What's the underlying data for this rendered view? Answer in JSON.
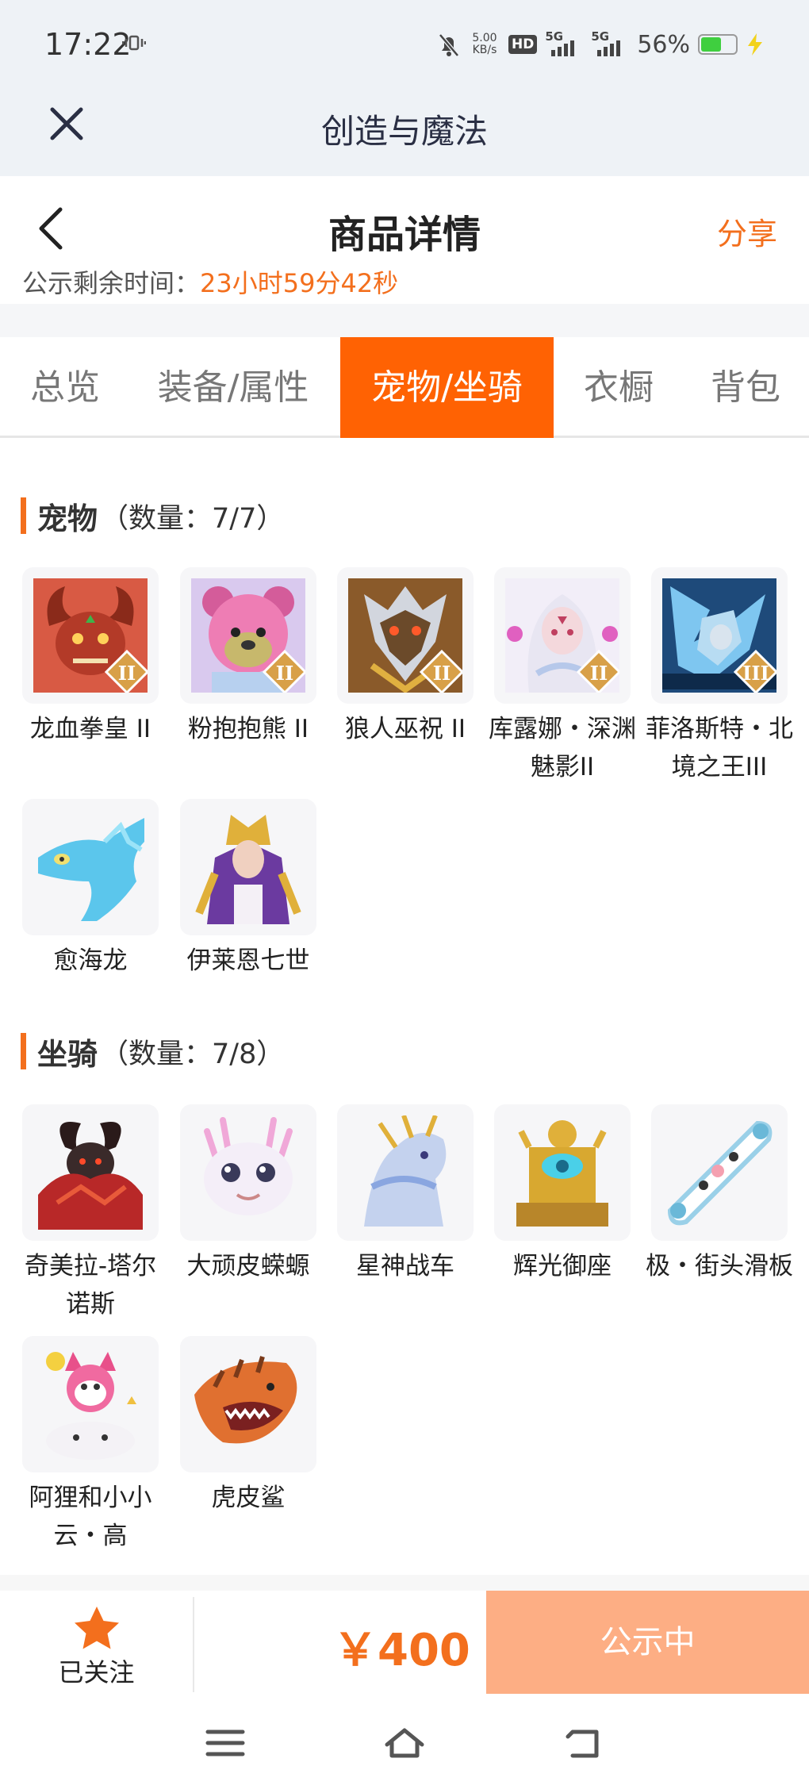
{
  "status_bar": {
    "time": "17:22",
    "net_speed": "5.00",
    "net_unit": "KB/s",
    "hd": "HD",
    "sig1": "5G",
    "sig2": "5G",
    "battery": "56%",
    "battery_level": 0.56
  },
  "app_header": {
    "title": "创造与魔法",
    "close_icon": "close-icon"
  },
  "page_header": {
    "title": "商品详情",
    "share": "分享"
  },
  "timer": {
    "label": "公示剩余时间：",
    "value": "23小时59分42秒"
  },
  "tabs": [
    {
      "label": "总览",
      "active": false
    },
    {
      "label": "装备/属性",
      "active": false
    },
    {
      "label": "宠物/坐骑",
      "active": true
    },
    {
      "label": "衣橱",
      "active": false
    },
    {
      "label": "背包",
      "active": false
    }
  ],
  "pets": {
    "name": "宠物",
    "count": "（数量：7/7）",
    "items": [
      {
        "label": "龙血拳皇 II",
        "icon": "red-dragon-icon",
        "badge": "II"
      },
      {
        "label": "粉抱抱熊 II",
        "icon": "pink-bear-icon",
        "badge": "II"
      },
      {
        "label": "狼人巫祝 II",
        "icon": "werewolf-icon",
        "badge": "II"
      },
      {
        "label": "库露娜・深渊魅影II",
        "icon": "white-hair-spirit-icon",
        "badge": "II"
      },
      {
        "label": "菲洛斯特・北境之王III",
        "icon": "ice-king-icon",
        "badge": "III"
      },
      {
        "label": "愈海龙",
        "icon": "sea-dragon-icon",
        "badge": ""
      },
      {
        "label": "伊莱恩七世",
        "icon": "pharaoh-icon",
        "badge": ""
      }
    ]
  },
  "mounts": {
    "name": "坐骑",
    "count": "（数量：7/8）",
    "items": [
      {
        "label": "奇美拉-塔尔诺斯",
        "icon": "chimera-icon"
      },
      {
        "label": "大顽皮蝾螈",
        "icon": "axolotl-icon"
      },
      {
        "label": "星神战车",
        "icon": "star-chariot-icon"
      },
      {
        "label": "辉光御座",
        "icon": "golden-throne-icon"
      },
      {
        "label": "极・街头滑板",
        "icon": "skateboard-icon"
      },
      {
        "label": "阿狸和小小云・高",
        "icon": "fox-cloud-icon"
      },
      {
        "label": "虎皮鲨",
        "icon": "tiger-shark-icon"
      }
    ]
  },
  "bottom_bar": {
    "follow": "已关注",
    "price": "￥400",
    "action": "公示中"
  },
  "colors": {
    "accent": "#f36f1d",
    "tab_active": "#ff6203",
    "action_btn": "#fdae84"
  }
}
